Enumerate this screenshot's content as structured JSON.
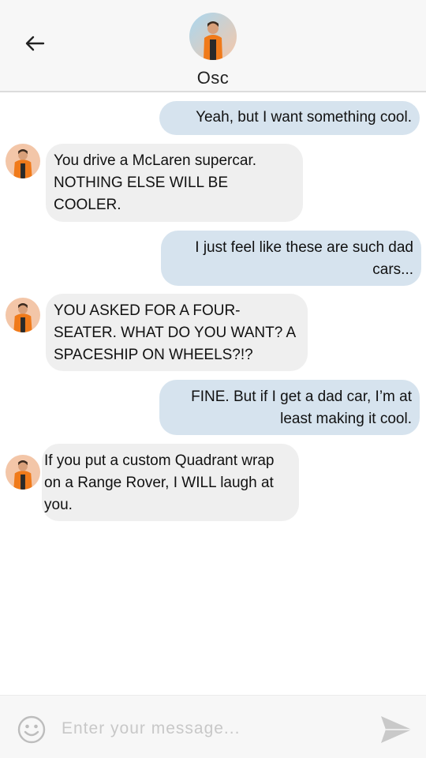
{
  "header": {
    "back_icon": "arrow-left-icon",
    "contact_name": "Osc"
  },
  "messages": [
    {
      "side": "sent",
      "text": "Yeah, but I want something cool."
    },
    {
      "side": "received",
      "text": "You drive a McLaren supercar. NOTHING ELSE WILL BE COOLER."
    },
    {
      "side": "sent",
      "text": "I just feel like these are such dad cars..."
    },
    {
      "side": "received",
      "text": "YOU ASKED FOR A FOUR-SEATER. WHAT DO YOU WANT? A SPACESHIP ON WHEELS?!?"
    },
    {
      "side": "sent",
      "text": "FINE. But if I get a dad car, I’m at least making it cool."
    },
    {
      "side": "received",
      "text": "If you put a custom Quadrant wrap on a Range Rover, I WILL laugh at you."
    }
  ],
  "input": {
    "placeholder": "Enter your message...",
    "emoji_icon": "smiley-icon",
    "send_icon": "send-icon"
  },
  "colors": {
    "sent_bubble": "#d6e3ee",
    "received_bubble": "#efefef",
    "avatar_orange": "#f07a1a"
  }
}
